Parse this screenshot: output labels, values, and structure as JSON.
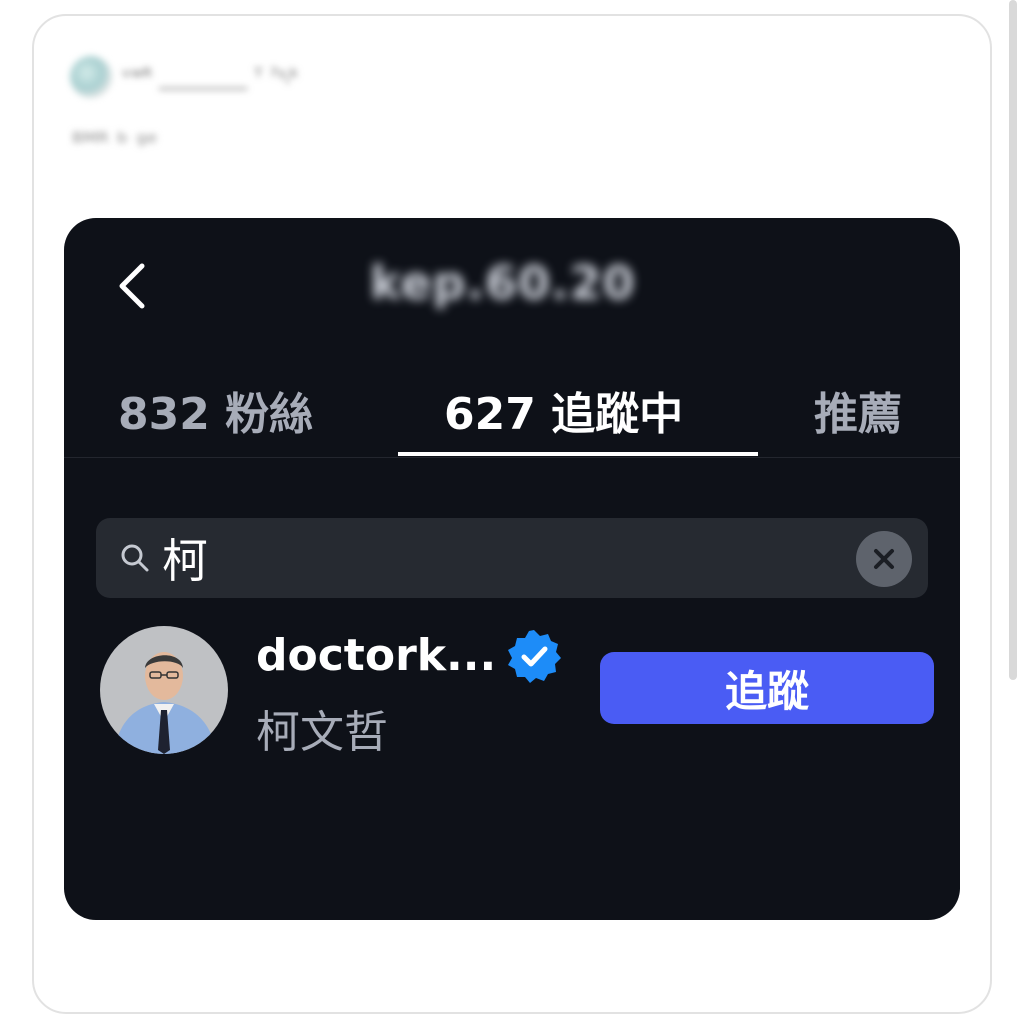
{
  "post": {
    "author_line": "ᵛʷᴿ ________ ᵀ ˀᵞᵢᵏ",
    "caption": "ᴮᴹᴿ ᵇ ᵍᵉ"
  },
  "profile": {
    "username": "kep.60.20",
    "tabs": [
      {
        "label": "832 粉絲"
      },
      {
        "label": "627 追蹤中"
      },
      {
        "label": "推薦"
      }
    ]
  },
  "search": {
    "value": "柯",
    "icon": "search-icon",
    "clear_icon": "clear-icon"
  },
  "results": [
    {
      "username": "doctork...",
      "full_name": "柯文哲",
      "verified": true,
      "button_label": "追蹤"
    }
  ],
  "colors": {
    "panel_bg": "#0e1118",
    "search_bg": "#262a31",
    "follow_button": "#4a5cf4",
    "verified_badge": "#1d8cf8",
    "muted_text": "#a7acb8"
  }
}
